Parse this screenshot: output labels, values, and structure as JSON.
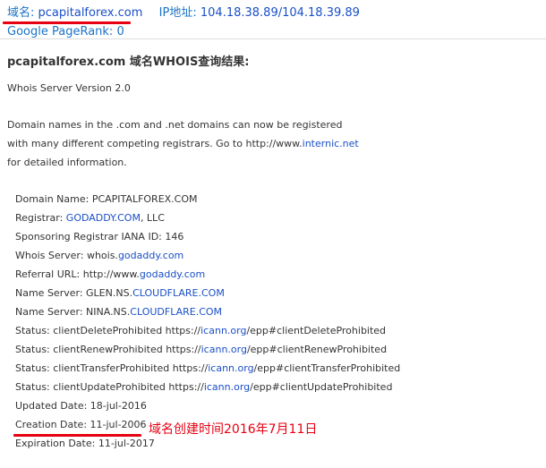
{
  "header": {
    "domain_label": "域名:",
    "domain": "pcapitalforex.com",
    "ip_label": "IP地址:",
    "ips": "104.18.38.89/104.18.39.89",
    "pagerank": "Google PageRank: 0"
  },
  "title": "pcapitalforex.com 域名WHOIS查询结果:",
  "server_version": "Whois Server Version 2.0",
  "intro": {
    "line1": "Domain names in the .com and .net domains can now be registered",
    "line2_pre": "with many different competing registrars. Go to http://www.",
    "line2_link": "internic.net",
    "line3": "for detailed information."
  },
  "records": {
    "domain_name": "Domain Name: PCAPITALFOREX.COM",
    "registrar_pre": "Registrar: ",
    "registrar_link": "GODADDY.COM",
    "registrar_post": ", LLC",
    "iana": "Sponsoring Registrar IANA ID: 146",
    "whois_pre": "Whois Server: whois.",
    "whois_link": "godaddy.com",
    "referral_pre": "Referral URL: http://www.",
    "referral_link": "godaddy.com",
    "ns1_pre": "Name Server: GLEN.NS.",
    "ns1_link": "CLOUDFLARE.COM",
    "ns2_pre": "Name Server: NINA.NS.",
    "ns2_link": "CLOUDFLARE.COM",
    "status1_pre": "Status: clientDeleteProhibited https://",
    "status1_link": "icann.org",
    "status1_post": "/epp#clientDeleteProhibited",
    "status2_pre": "Status: clientRenewProhibited https://",
    "status2_link": "icann.org",
    "status2_post": "/epp#clientRenewProhibited",
    "status3_pre": "Status: clientTransferProhibited https://",
    "status3_link": "icann.org",
    "status3_post": "/epp#clientTransferProhibited",
    "status4_pre": "Status: clientUpdateProhibited https://",
    "status4_link": "icann.org",
    "status4_post": "/epp#clientUpdateProhibited",
    "updated": "Updated Date: 18-jul-2016",
    "creation": "Creation Date: 11-jul-2006",
    "expiration": "Expiration Date: 11-jul-2017"
  },
  "annotation": "域名创建时间2016年7月11日",
  "colors": {
    "accent_red": "#e60012",
    "link_blue": "#1a4fc7",
    "header_blue": "#1a73c7"
  }
}
